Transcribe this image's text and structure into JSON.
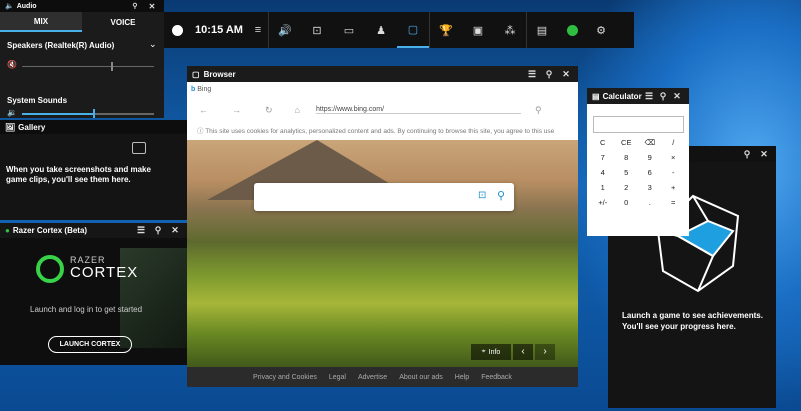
{
  "colors": {
    "accent": "#4ab0e8",
    "panel": "#1b1b1b",
    "gamebar_green": "#2fbf40"
  },
  "audio": {
    "title": "Audio",
    "tabs": [
      "MIX",
      "VOICE"
    ],
    "device": "Speakers (Realtek(R) Audio)",
    "system_sounds": "System Sounds"
  },
  "gallery": {
    "title": "Gallery",
    "message": "When you take screenshots and make game clips, you'll see them here."
  },
  "razer": {
    "title": "Razer Cortex (Beta)",
    "logo_top": "RAZER",
    "logo_bottom": "CORTEX",
    "prompt": "Launch and log in to get started",
    "button": "LAUNCH CORTEX"
  },
  "gamebar": {
    "time": "10:15 AM",
    "icons": [
      "xbox-icon",
      "menu-icon",
      "audio-icon",
      "capture-icon",
      "performance-icon",
      "squad-icon",
      "browser-icon",
      "achievements-icon",
      "screen-icon",
      "resources-icon",
      "calculator-icon",
      "spotify-icon",
      "settings-icon"
    ]
  },
  "browser": {
    "title": "Browser",
    "tab": "Bing",
    "url": "https://www.bing.com/",
    "cookie_notice": "This site uses cookies for analytics, personalized content and ads. By continuing to browse this site, you agree to this use",
    "info": "Info",
    "footer": [
      "Privacy and Cookies",
      "Legal",
      "Advertise",
      "About our ads",
      "Help",
      "Feedback"
    ]
  },
  "calculator": {
    "title": "Calculator",
    "keys": [
      "C",
      "CE",
      "⌫",
      "/",
      "7",
      "8",
      "9",
      "×",
      "4",
      "5",
      "6",
      "-",
      "1",
      "2",
      "3",
      "+",
      "+/-",
      "0",
      ".",
      "="
    ]
  },
  "achievements": {
    "line1": "Launch a game to see achievements.",
    "line2": "You'll see your progress here."
  }
}
